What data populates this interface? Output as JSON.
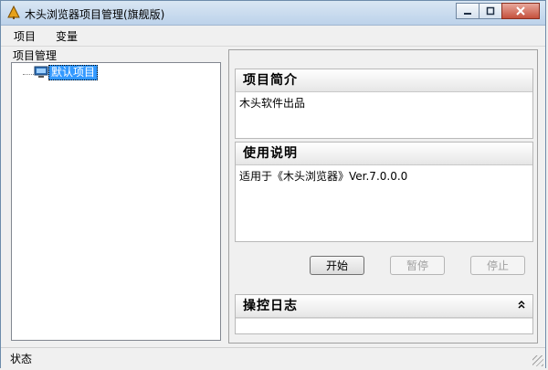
{
  "window": {
    "title": "木头浏览器项目管理(旗舰版)"
  },
  "menu": {
    "items": [
      "项目",
      "变量"
    ]
  },
  "left": {
    "label": "项目管理",
    "tree": {
      "items": [
        {
          "label": "默认项目",
          "selected": true
        }
      ]
    }
  },
  "panel": {
    "intro": {
      "title": "项目简介",
      "text": "木头软件出品"
    },
    "usage": {
      "title": "使用说明",
      "text": "适用于《木头浏览器》Ver.7.0.0.0"
    },
    "buttons": {
      "start": "开始",
      "pause": "暂停",
      "stop": "停止"
    },
    "log": {
      "title": "操控日志"
    }
  },
  "status": {
    "text": "状态"
  },
  "icons": {
    "app": "tree-app-icon",
    "minimize": "minimize-icon",
    "maximize": "maximize-icon",
    "close": "close-icon",
    "project": "monitor-icon",
    "collapse": "double-chevron-up-icon"
  },
  "colors": {
    "selection": "#3399ff",
    "titlebar": "#c7d9ed",
    "close": "#c5503c"
  }
}
